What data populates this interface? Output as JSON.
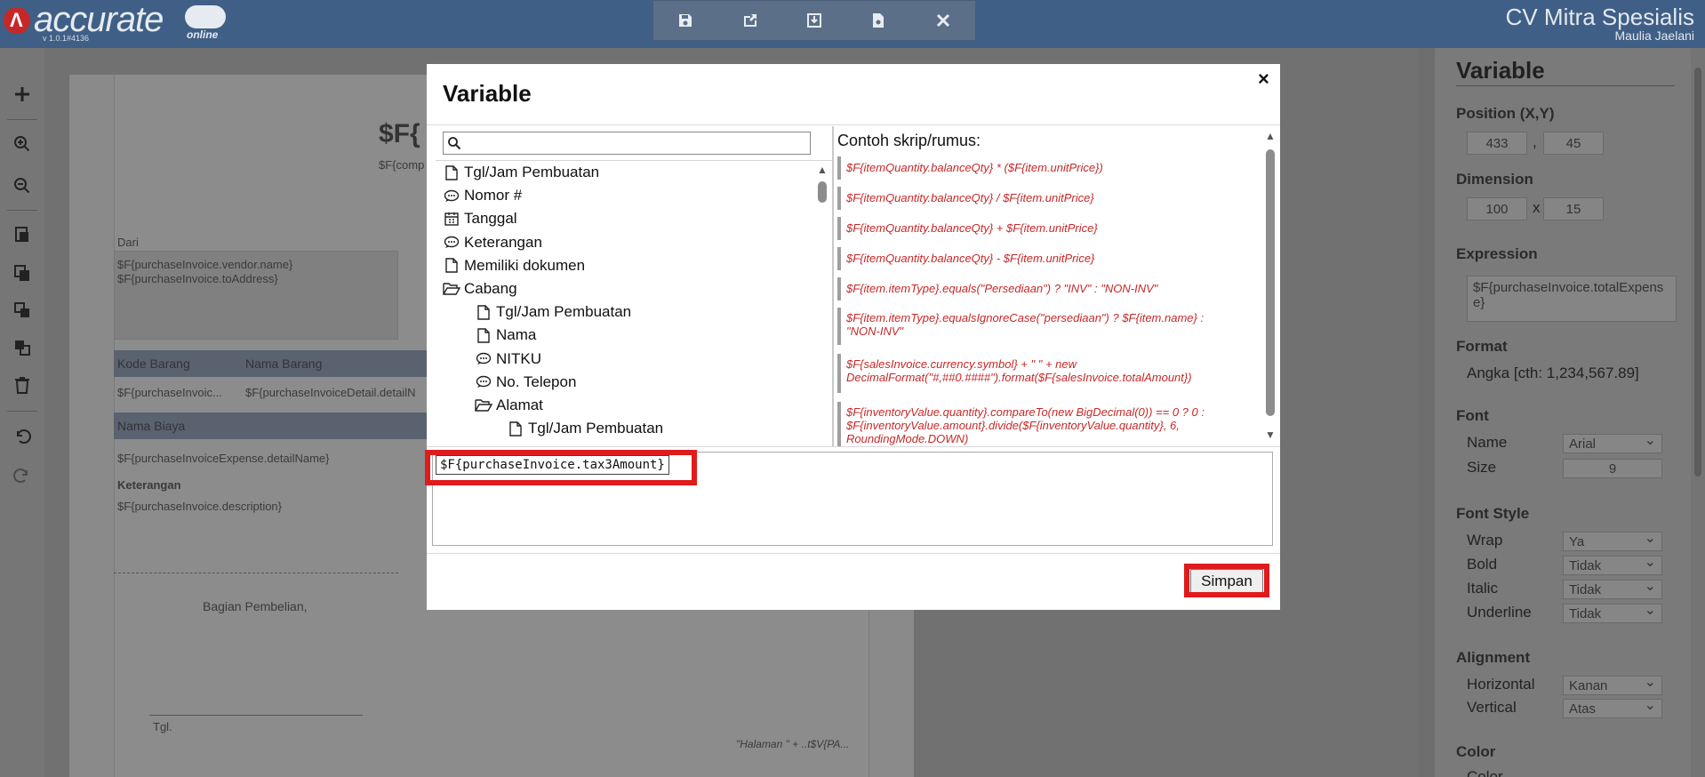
{
  "topbar": {
    "logo_text": "accurate",
    "logo_sub": "online",
    "version": "v 1.0.1#4136",
    "company": "CV Mitra Spesialis",
    "user": "Maulia Jaelani",
    "tools": [
      {
        "icon": "save-icon"
      },
      {
        "icon": "export-icon"
      },
      {
        "icon": "import-icon"
      },
      {
        "icon": "preview-icon"
      },
      {
        "icon": "close-icon"
      }
    ]
  },
  "report": {
    "title_var": "$F{",
    "company_var": "$F{comp",
    "dari_label": "Dari",
    "vendor_name": "$F{purchaseInvoice.vendor.name}",
    "to_address": "$F{purchaseInvoice.toAddress}",
    "col_kode": "Kode Barang",
    "col_nama": "Nama Barang",
    "detail_kode": "$F{purchaseInvoic...",
    "detail_nama": "$F{purchaseInvoiceDetail.detailN",
    "col_biaya": "Nama Biaya",
    "expense_detail": "$F{purchaseInvoiceExpense.detailName}",
    "keterangan_label": "Keterangan",
    "description": "$F{purchaseInvoice.description}",
    "bagian": "Bagian Pembelian,",
    "tgl": "Tgl.",
    "halaman": "\"Halaman \" + ..t$V{PA..."
  },
  "right_panel": {
    "title": "Variable",
    "position_label": "Position (X,Y)",
    "pos_x": "433",
    "pos_sep": ",",
    "pos_y": "45",
    "dimension_label": "Dimension",
    "dim_w": "100",
    "dim_sep": "x",
    "dim_h": "15",
    "expression_label": "Expression",
    "expression_value": "$F{purchaseInvoice.totalExpense}",
    "format_label": "Format",
    "format_value": "Angka [cth: 1,234,567.89]",
    "font_label": "Font",
    "name_label": "Name",
    "name_value": "Arial",
    "size_label": "Size",
    "size_value": "9",
    "font_style_label": "Font Style",
    "wrap_label": "Wrap",
    "wrap_value": "Ya",
    "bold_label": "Bold",
    "bold_value": "Tidak",
    "italic_label": "Italic",
    "italic_value": "Tidak",
    "underline_label": "Underline",
    "underline_value": "Tidak",
    "alignment_label": "Alignment",
    "horizontal_label": "Horizontal",
    "horizontal_value": "Kanan",
    "vertical_label": "Vertical",
    "vertical_value": "Atas",
    "color_label": "Color",
    "color_sub": "Color"
  },
  "modal": {
    "title": "Variable",
    "close": "×",
    "search_placeholder": "",
    "tree": [
      {
        "label": "Tgl/Jam Pembuatan",
        "icon": "file-icon",
        "indent": 0
      },
      {
        "label": "Nomor #",
        "icon": "comment-icon",
        "indent": 0
      },
      {
        "label": "Tanggal",
        "icon": "calendar-icon",
        "indent": 0
      },
      {
        "label": "Keterangan",
        "icon": "comment-icon",
        "indent": 0
      },
      {
        "label": "Memiliki dokumen",
        "icon": "file-icon",
        "indent": 0
      },
      {
        "label": "Cabang",
        "icon": "folder-open-icon",
        "indent": 0
      },
      {
        "label": "Tgl/Jam Pembuatan",
        "icon": "file-icon",
        "indent": 1
      },
      {
        "label": "Nama",
        "icon": "file-icon",
        "indent": 1
      },
      {
        "label": "NITKU",
        "icon": "comment-icon",
        "indent": 1
      },
      {
        "label": "No. Telepon",
        "icon": "comment-icon",
        "indent": 1
      },
      {
        "label": "Alamat",
        "icon": "folder-open-icon",
        "indent": 1
      },
      {
        "label": "Tgl/Jam Pembuatan",
        "icon": "file-icon",
        "indent": 2
      }
    ],
    "examples_title": "Contoh skrip/rumus:",
    "examples": [
      "$F{itemQuantity.balanceQty} * ($F{item.unitPrice})",
      "$F{itemQuantity.balanceQty} / $F{item.unitPrice}",
      "$F{itemQuantity.balanceQty} + $F{item.unitPrice}",
      "$F{itemQuantity.balanceQty} - $F{item.unitPrice}",
      "$F{item.itemType}.equals(\"Persediaan\") ? \"INV\" : \"NON-INV\"",
      "$F{item.itemType}.equalsIgnoreCase(\"persediaan\") ? $F{item.name} : \"NON-INV\"",
      "$F{salesInvoice.currency.symbol} + \" \" + new DecimalFormat(\"#,##0.####\").format($F{salesInvoice.totalAmount})",
      "$F{inventoryValue.quantity}.compareTo(new BigDecimal(0)) == 0 ? 0 : $F{inventoryValue.amount}.divide($F{inventoryValue.quantity}, 6, RoundingMode.DOWN)"
    ],
    "expression": "$F{purchaseInvoice.tax3Amount}",
    "save_label": "Simpan"
  }
}
